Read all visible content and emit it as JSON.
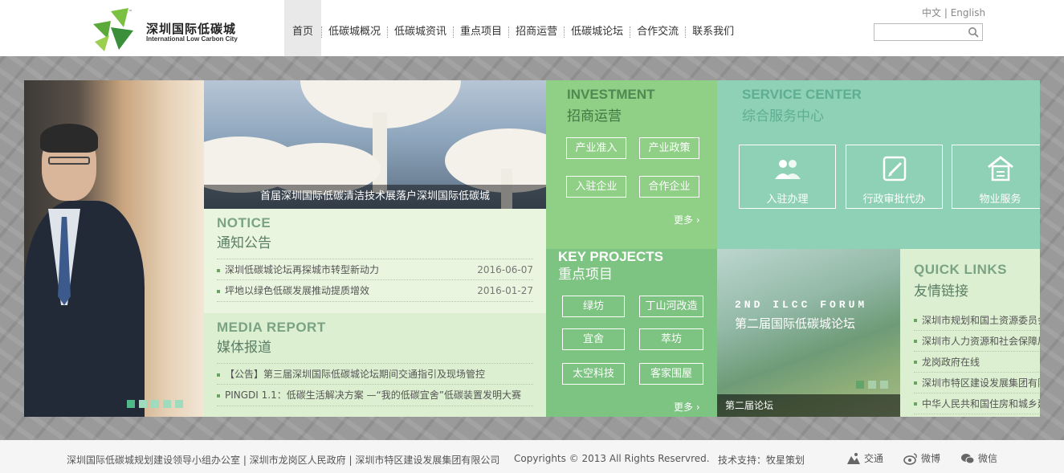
{
  "brand": {
    "name_cn": "深圳国际低碳城",
    "name_en": "International Low Carbon City",
    "tm": "™"
  },
  "nav": {
    "items": [
      "首页",
      "低碳城概况",
      "低碳城资讯",
      "重点项目",
      "招商运营",
      "低碳城论坛",
      "合作交流",
      "联系我们"
    ]
  },
  "lang": {
    "cn": "中文",
    "sep": "|",
    "en": "English"
  },
  "search": {
    "placeholder": ""
  },
  "slider": {
    "dots": 5,
    "active": 0
  },
  "banner": {
    "caption": "首届深圳国际低碳清洁技术展落户深圳国际低碳城"
  },
  "notice": {
    "title_en": "NOTICE",
    "title_cn": "通知公告",
    "items": [
      {
        "text": "深圳低碳城论坛再探城市转型新动力",
        "date": "2016-06-07"
      },
      {
        "text": "坪地以绿色低碳发展推动提质增效",
        "date": "2016-01-27"
      }
    ]
  },
  "media": {
    "title_en": "MEDIA REPORT",
    "title_cn": "媒体报道",
    "items": [
      "【公告】第三届深圳国际低碳城论坛期间交通指引及现场管控",
      "PINGDI 1.1：低碳生活解决方案 —“我的低碳宜舍”低碳装置发明大赛"
    ]
  },
  "investment": {
    "title_en": "INVESTMENT",
    "title_cn": "招商运营",
    "buttons": [
      "产业准入",
      "产业政策",
      "入驻企业",
      "合作企业"
    ],
    "more": "更多"
  },
  "key_projects": {
    "title_en": "KEY PROJECTS",
    "title_cn": "重点项目",
    "buttons": [
      "绿坊",
      "丁山河改造",
      "宜舍",
      "萃坊",
      "太空科技",
      "客家围屋"
    ],
    "more": "更多"
  },
  "service": {
    "title_en": "SERVICE CENTER",
    "title_cn": "综合服务中心",
    "items": [
      "入驻办理",
      "行政审批代办",
      "物业服务"
    ]
  },
  "forum": {
    "title_en": "2ND ILCC FORUM",
    "title_cn": "第二届国际低碳城论坛",
    "label": "第二届论坛",
    "dots": 3,
    "active": 0
  },
  "quick_links": {
    "title_en": "QUICK LINKS",
    "title_cn": "友情链接",
    "items": [
      "深圳市规划和国土资源委员会",
      "深圳市人力资源和社会保障局",
      "龙岗政府在线",
      "深圳市特区建设发展集团有限",
      "中华人民共和国住房和城乡建"
    ]
  },
  "footer": {
    "links": "深圳国际低碳城规划建设领导小组办公室 | 深圳市龙岗区人民政府 | 深圳市特区建设发展集团有限公司",
    "copyright": "Copyrights © 2013 All Rights Reservred.",
    "tech": "技术支持：牧星策划",
    "traffic": "交通",
    "weibo": "微博",
    "wechat": "微信"
  },
  "colors": {
    "notice_bg": "#e9f5de",
    "invest_bg": "#8fcf86",
    "service_bg": "#8ed1b6",
    "key_bg": "#7dc381"
  }
}
